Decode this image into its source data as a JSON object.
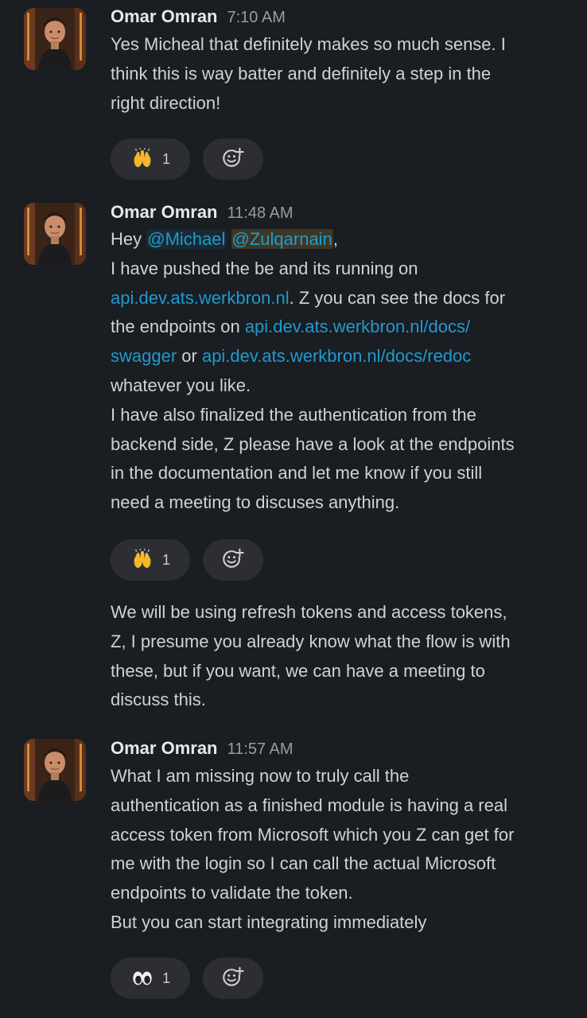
{
  "messages": [
    {
      "author": "Omar Omran",
      "time": "7:10 AM",
      "lines": [
        "Yes Micheal that definitely makes so much sense. I",
        "think this is way batter and definitely a step in the",
        "right direction!"
      ],
      "reaction": {
        "emoji": "raised-hands",
        "count": "1"
      }
    },
    {
      "author": "Omar Omran",
      "time": "11:48 AM",
      "hey": "Hey",
      "mention1": "@Michael",
      "mention2": "@Zulqarnain",
      "comma": ",",
      "line2": "I have pushed the be and its running on",
      "link1": "api.dev.ats.werkbron.nl",
      "line3_rest": ". Z you can see the docs for",
      "line4_start": "the endpoints on ",
      "link2a": "api.dev.ats.werkbron.nl/docs/",
      "link2b": "swagger",
      "or_text": " or ",
      "link3": "api.dev.ats.werkbron.nl/docs/redoc",
      "line6": "whatever you like.",
      "line7": "I have also finalized the authentication from the",
      "line8": "backend side, Z please have a look at the endpoints",
      "line9": "in the documentation and let me know if you still",
      "line10": "need a meeting to discuses anything.",
      "reaction": {
        "emoji": "raised-hands",
        "count": "1"
      }
    },
    {
      "continuation": true,
      "lines": [
        "We will be using refresh tokens and access tokens,",
        "Z, I presume you already know what the flow is with",
        "these, but if you want, we can have a meeting to",
        "discuss this."
      ]
    },
    {
      "author": "Omar Omran",
      "time": "11:57 AM",
      "lines": [
        "What I am missing now to truly call the",
        "authentication as a finished module is having a real",
        "access token from Microsoft which you Z can get for",
        "me with the login so I can call the actual Microsoft",
        "endpoints to validate the token.",
        "But you can start integrating immediately"
      ],
      "reaction": {
        "emoji": "eyes",
        "count": "1"
      }
    }
  ],
  "icons": {
    "add_reaction": "add-reaction-icon",
    "raised_hands": "raised-hands-emoji",
    "eyes": "eyes-emoji"
  },
  "colors": {
    "background": "#1a1d21",
    "link": "#1d9bd1",
    "pill": "#2c2e33"
  }
}
